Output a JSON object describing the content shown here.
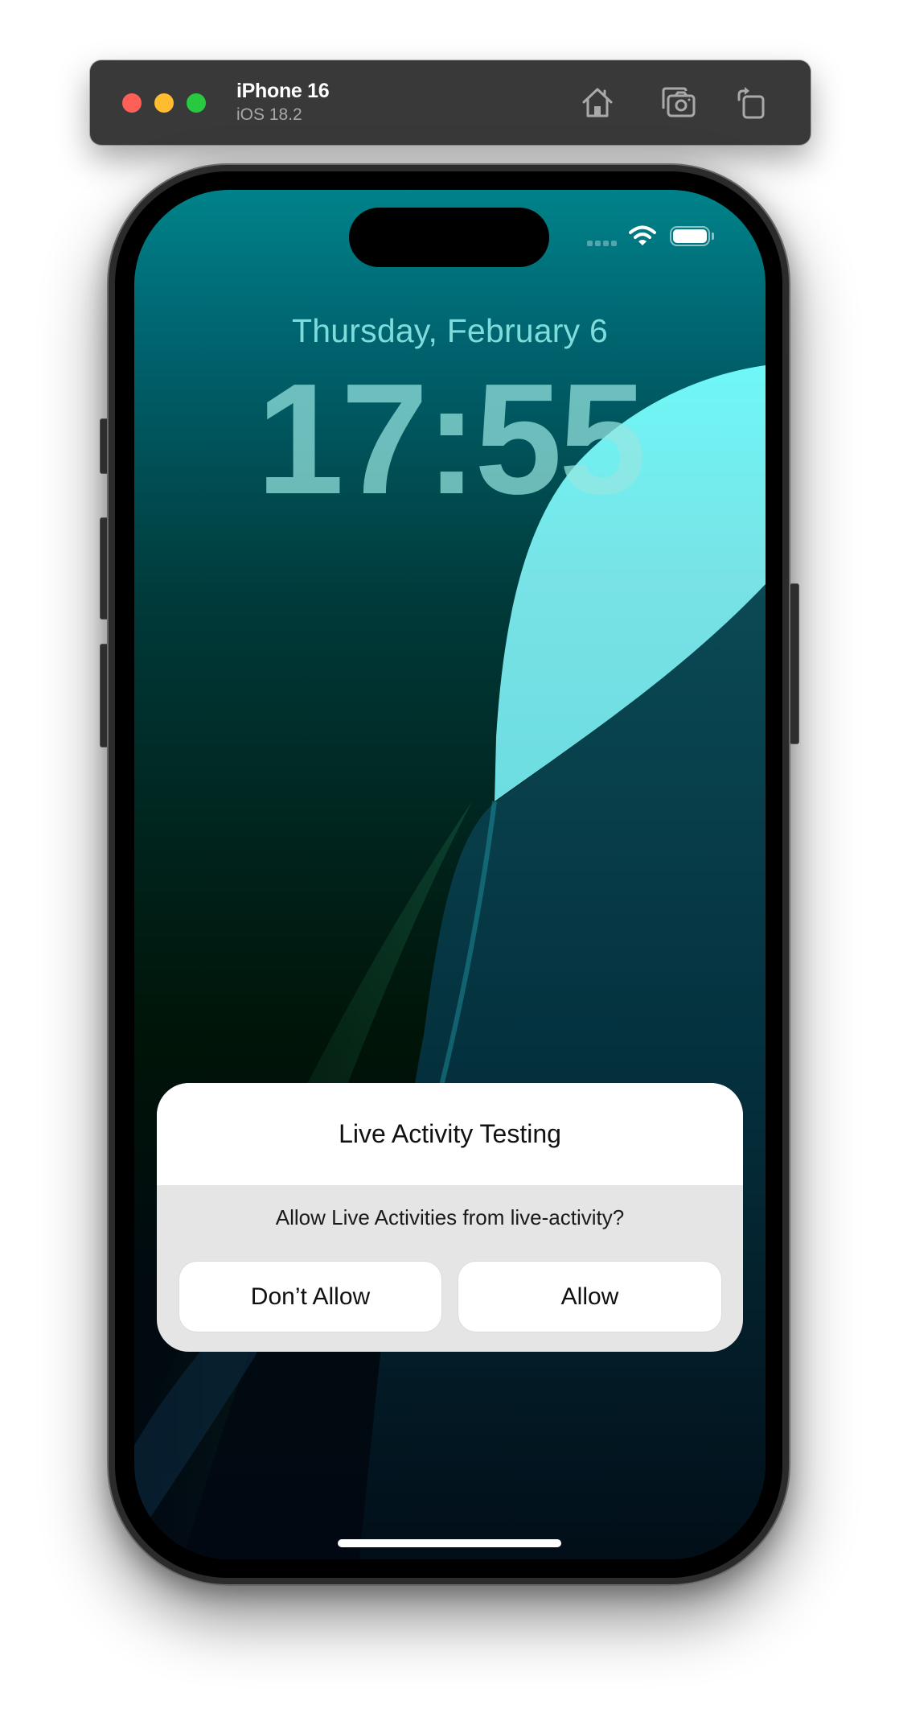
{
  "simulator": {
    "device_name": "iPhone 16",
    "os_version": "iOS 18.2",
    "window_controls": [
      {
        "name": "close",
        "color": "#fe5f57"
      },
      {
        "name": "minimize",
        "color": "#febc2e"
      },
      {
        "name": "zoom",
        "color": "#28c840"
      }
    ],
    "toolbar_icons": [
      "home-icon",
      "screenshot-icon",
      "rotate-icon"
    ]
  },
  "status_bar": {
    "cellular": "no-signal-dots",
    "wifi": "wifi-icon",
    "battery": "battery-full-icon"
  },
  "lock_screen": {
    "date": "Thursday, February 6",
    "time": "17:55"
  },
  "alert": {
    "title": "Live Activity Testing",
    "message": "Allow Live Activities from live-activity?",
    "buttons": [
      {
        "label": "Don’t Allow"
      },
      {
        "label": "Allow"
      }
    ]
  }
}
